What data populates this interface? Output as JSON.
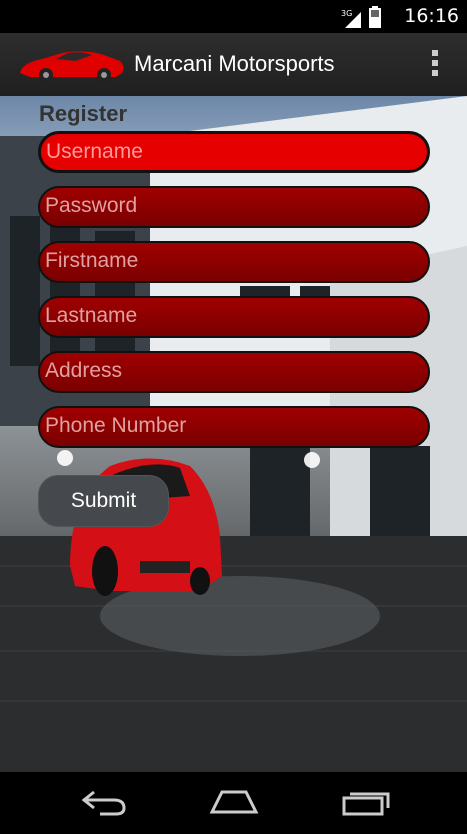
{
  "status_bar": {
    "network": "3G",
    "time": "16:16",
    "icons": [
      "signal-icon",
      "battery-icon"
    ]
  },
  "action_bar": {
    "logo": "red-car-logo-icon",
    "title": "Marcani Motorsports",
    "menu_icon": "overflow-menu-icon"
  },
  "form": {
    "heading": "Register",
    "fields": [
      {
        "placeholder": "Username"
      },
      {
        "placeholder": "Password"
      },
      {
        "placeholder": "Firstname"
      },
      {
        "placeholder": "Lastname"
      },
      {
        "placeholder": "Address"
      },
      {
        "placeholder": "Phone Number"
      }
    ],
    "submit_label": "Submit"
  },
  "colors": {
    "field_active": "#e60000",
    "field": "#8a0000",
    "button": "#45484d"
  },
  "nav_bar": {
    "icons": [
      "back-icon",
      "home-icon",
      "recent-apps-icon"
    ]
  }
}
